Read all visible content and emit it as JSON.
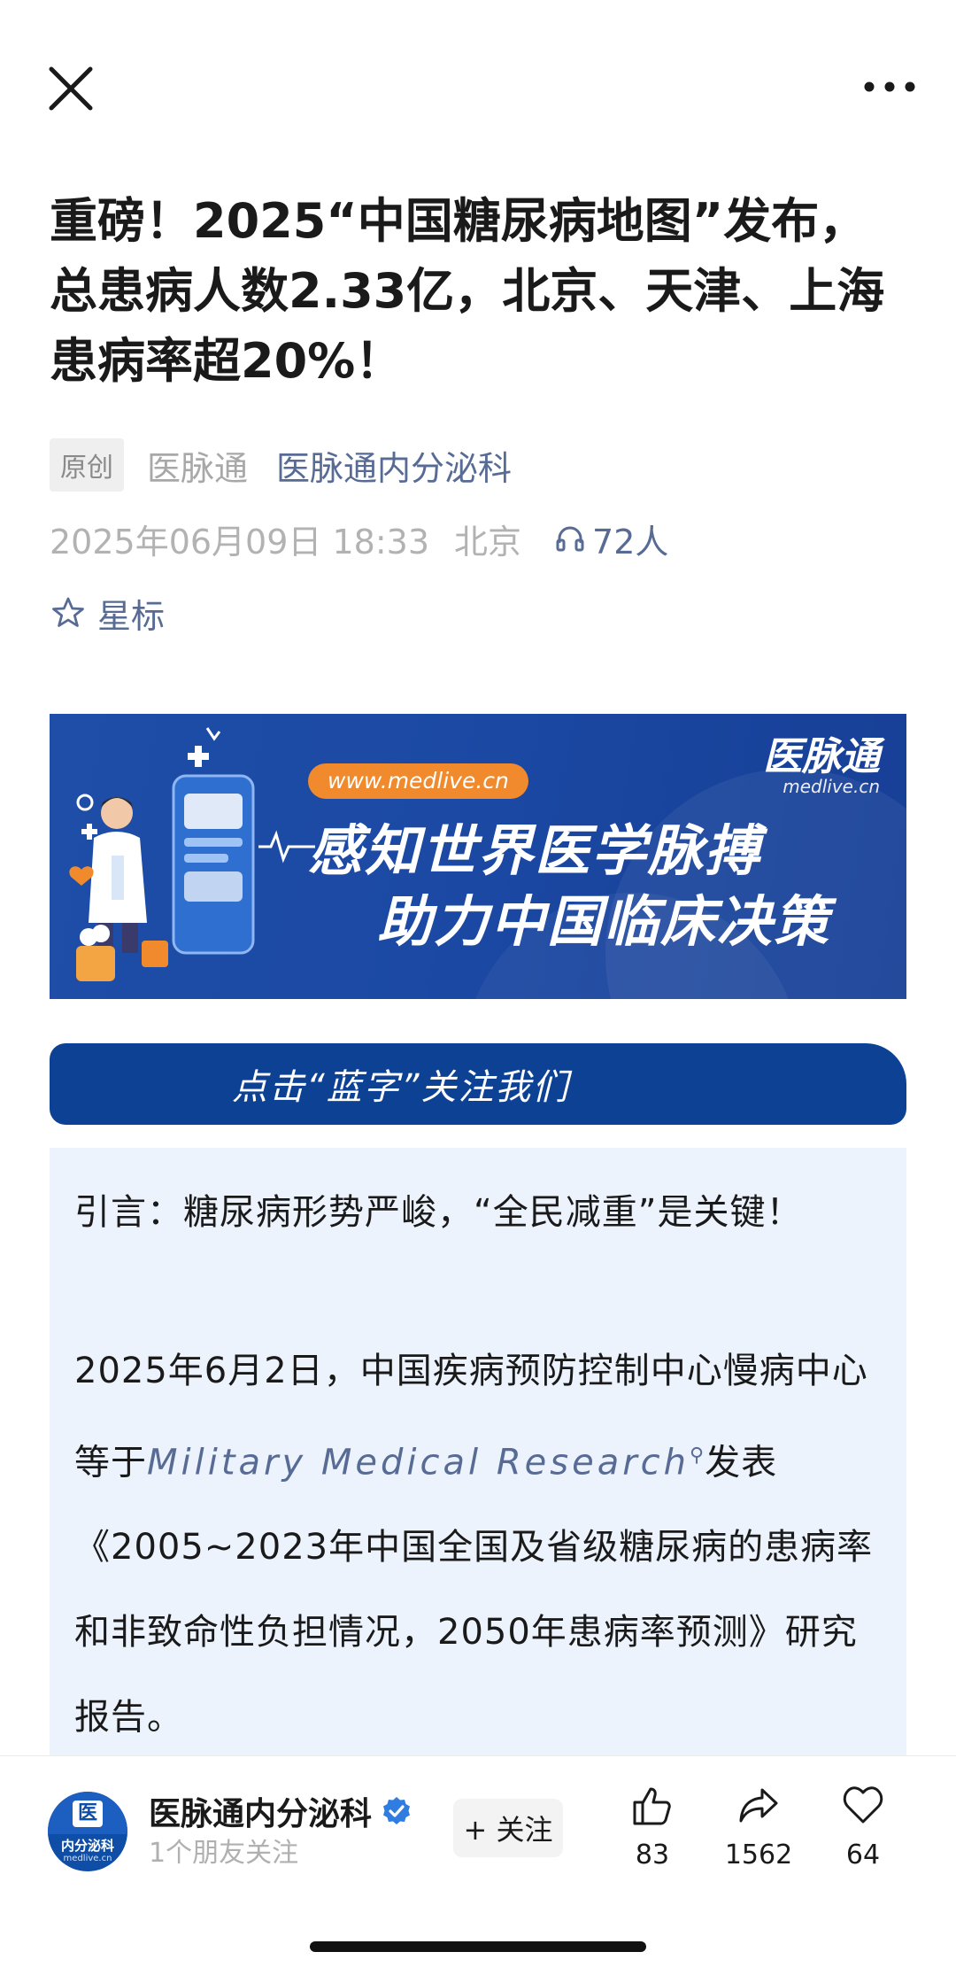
{
  "article": {
    "title": "重磅！2025“中国糖尿病地图”发布，总患病人数2.33亿，北京、天津、上海患病率超20%！",
    "original_tag": "原创",
    "source_name": "医脉通",
    "account_link": "医脉通内分泌科",
    "datetime": "2025年06月09日 18:33",
    "location": "北京",
    "listeners": "72人",
    "star_label": "星标"
  },
  "banner": {
    "url": "www.medlive.cn",
    "logo_text": "医脉通",
    "logo_sub": "medlive.cn",
    "slogan_line1": "感知世界医学脉搏",
    "slogan_line2": "助力中国临床决策"
  },
  "follow_bar": {
    "label": "点击“蓝字”关注我们"
  },
  "content": {
    "intro": "引言：糖尿病形势严峻，“全民减重”是关键！",
    "body_before": "2025年6月2日，中国疾病预防控制中心慢病中心等于",
    "journal": "Military Medical Research",
    "body_after": "发表《2005~2023年中国全国及省级糖尿病的患病率和非致命性负担情况，2050年患病率预测》研究报告。"
  },
  "bottom_bar": {
    "avatar_badge": "医",
    "avatar_name": "内分泌科",
    "avatar_url": "medlive.cn",
    "account_name": "医脉通内分泌科",
    "friends_following": "1个朋友关注",
    "follow_button": "+ 关注",
    "likes": "83",
    "shares": "1562",
    "favorites": "64"
  },
  "colors": {
    "link_blue": "#576b95",
    "banner_blue": "#1b49a4",
    "follow_bar_blue": "#0d4194",
    "content_bg": "#edf3fc",
    "url_pill_orange": "#f08a2c",
    "verified_blue": "#2f7de1"
  },
  "icons": [
    "close-icon",
    "more-icon",
    "headphones-icon",
    "star-icon",
    "search-icon",
    "verified-icon",
    "thumbs-up-icon",
    "share-icon",
    "heart-icon"
  ]
}
